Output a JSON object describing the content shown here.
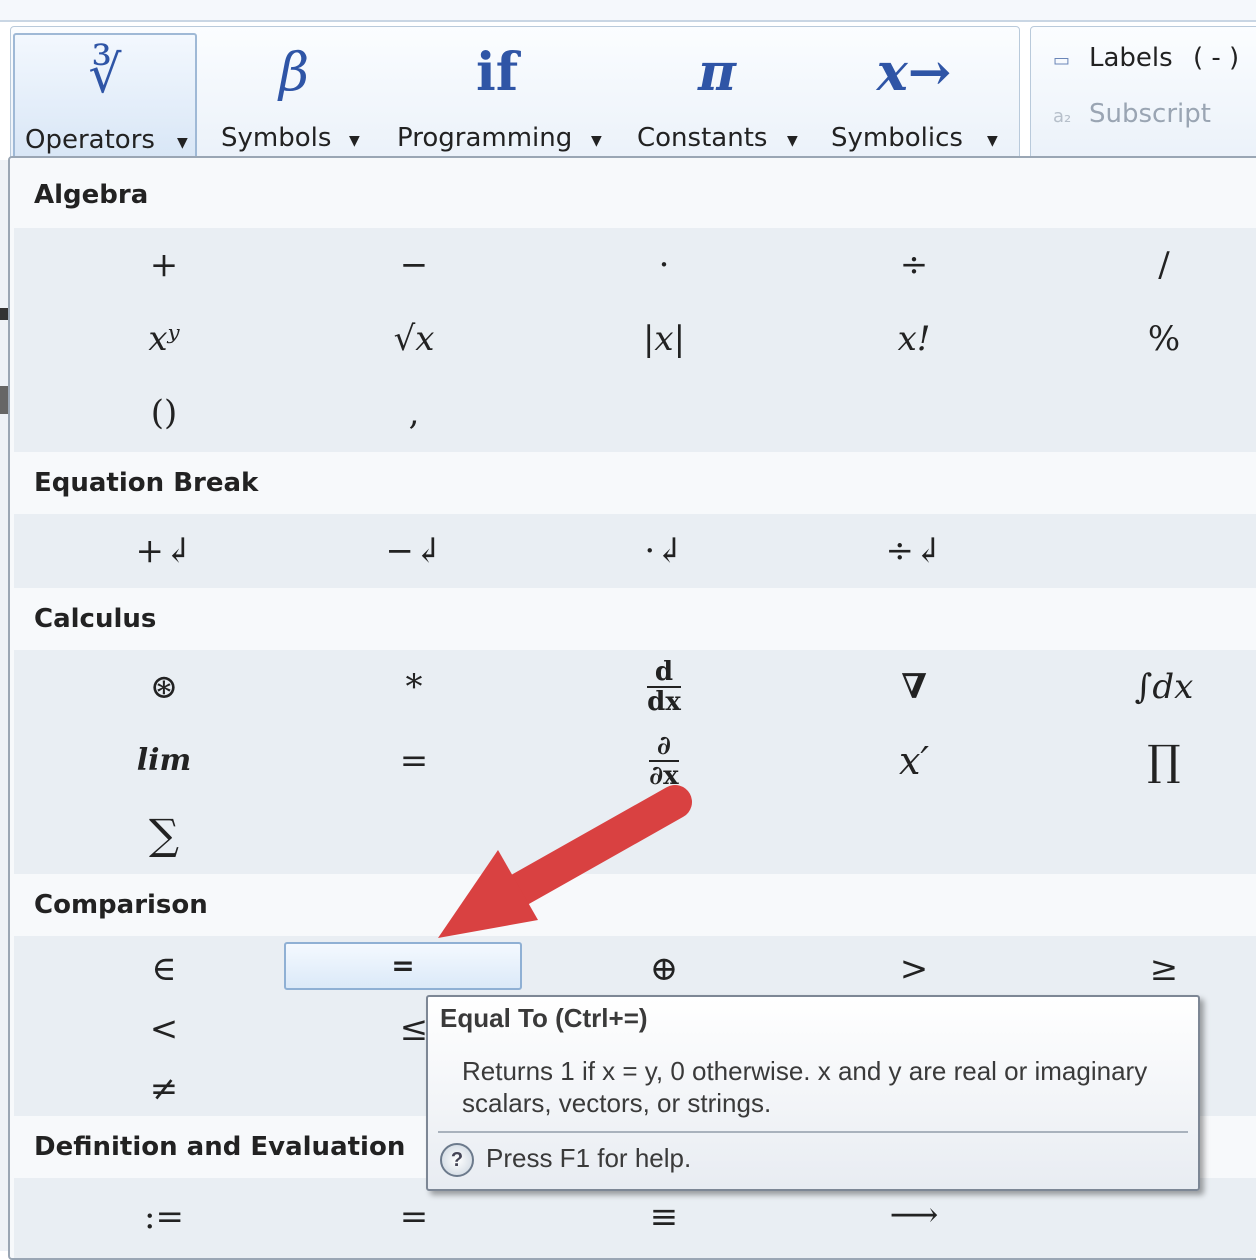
{
  "ribbon": {
    "buttons": [
      {
        "label": "Operators",
        "icon": "∛",
        "icon_name": "cube-root-icon",
        "active": true
      },
      {
        "label": "Symbols",
        "icon": "β",
        "icon_name": "beta-icon"
      },
      {
        "label": "Programming",
        "icon": "if",
        "icon_name": "if-icon"
      },
      {
        "label": "Constants",
        "icon": "π",
        "icon_name": "pi-icon"
      },
      {
        "label": "Symbolics",
        "icon": "x→",
        "icon_name": "symbolic-arrow-icon"
      }
    ],
    "labels": {
      "label": "Labels",
      "value": "( - )"
    },
    "subscript": {
      "label": "Subscript"
    }
  },
  "sections": {
    "algebra": {
      "title": "Algebra",
      "row1": [
        "+",
        "−",
        "·",
        "÷",
        "/"
      ],
      "row2": [
        "xʸ",
        "√x",
        "|x|",
        "x!",
        "%"
      ],
      "row3": [
        "()",
        ","
      ]
    },
    "equation_break": {
      "title": "Equation Break",
      "row1": [
        "+↲",
        "−↲",
        "·↲",
        "÷↲"
      ]
    },
    "calculus": {
      "title": "Calculus",
      "row1": [
        "⊛",
        "*",
        "",
        "∇",
        "∫dx"
      ],
      "deriv": {
        "num": "d",
        "den": "dx"
      },
      "row2": [
        "lim",
        "=",
        "",
        "x′",
        "∏"
      ],
      "partial": {
        "num": "∂",
        "den": "∂x"
      },
      "row3": [
        "∑"
      ]
    },
    "comparison": {
      "title": "Comparison",
      "row1": [
        "∈",
        "=",
        "⊕",
        ">",
        "≥"
      ],
      "row2": [
        "<",
        "≤"
      ],
      "row3": [
        "≠"
      ]
    },
    "definition": {
      "title": "Definition and Evaluation",
      "row1": [
        ":=",
        "=",
        "≡",
        "⟶"
      ]
    }
  },
  "tooltip": {
    "title": "Equal To (Ctrl+=)",
    "body": "Returns 1 if x = y, 0 otherwise. x and y are real or imaginary scalars, vectors, or strings.",
    "help": "Press F1 for help."
  },
  "colors": {
    "accent": "#2f55a6",
    "arrow": "#d94141",
    "highlight_border": "#8fb0d4"
  }
}
